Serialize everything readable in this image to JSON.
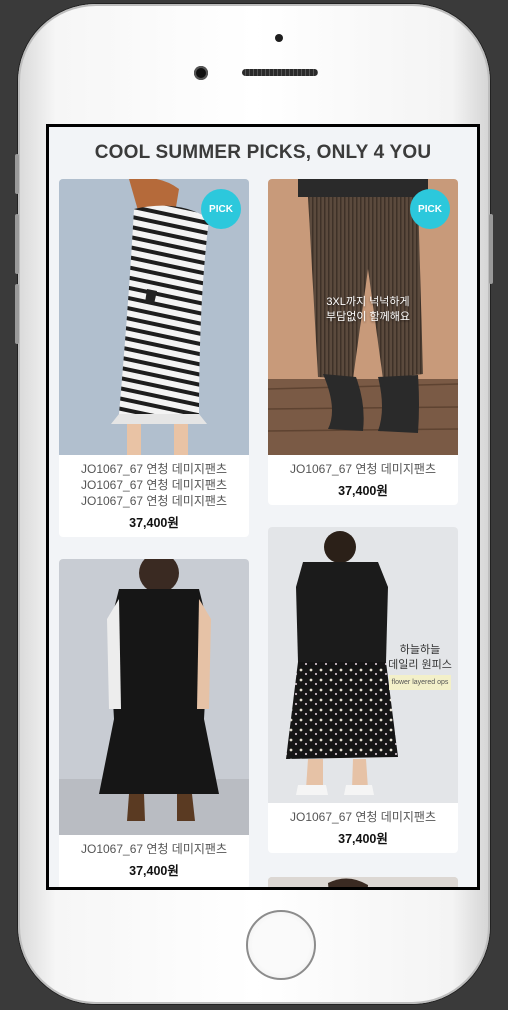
{
  "header": {
    "title": "COOL SUMMER PICKS, ONLY 4 YOU"
  },
  "products": [
    {
      "badge": "PICK",
      "caption_lines": [
        "JO1067_67 연청 데미지팬츠",
        "JO1067_67 연청 데미지팬츠",
        "JO1067_67 연청 데미지팬츠"
      ],
      "price": "37,400원",
      "image": "striped-dress-photo"
    },
    {
      "badge": "PICK",
      "caption_lines": [
        "JO1067_67 연청 데미지팬츠"
      ],
      "price": "37,400원",
      "image": "corduroy-pants-photo",
      "overlay": {
        "line1": "3XL까지 넉넉하게",
        "line2": "부담없이 함께해요"
      }
    },
    {
      "caption_lines": [
        "JO1067_67 연청 데미지팬츠"
      ],
      "price": "37,400원",
      "image": "black-dress-photo"
    },
    {
      "caption_lines": [
        "JO1067_67 연청 데미지팬츠"
      ],
      "price": "37,400원",
      "image": "hoodie-floral-skirt-photo",
      "overlay": {
        "line1": "하늘하늘",
        "line2": "데일리 원피스",
        "tag": "flower layered ops"
      }
    }
  ],
  "colors": {
    "accent": "#2cc8dc",
    "screen_bg": "#f2f4f7",
    "frame": "#3a3a3a"
  }
}
